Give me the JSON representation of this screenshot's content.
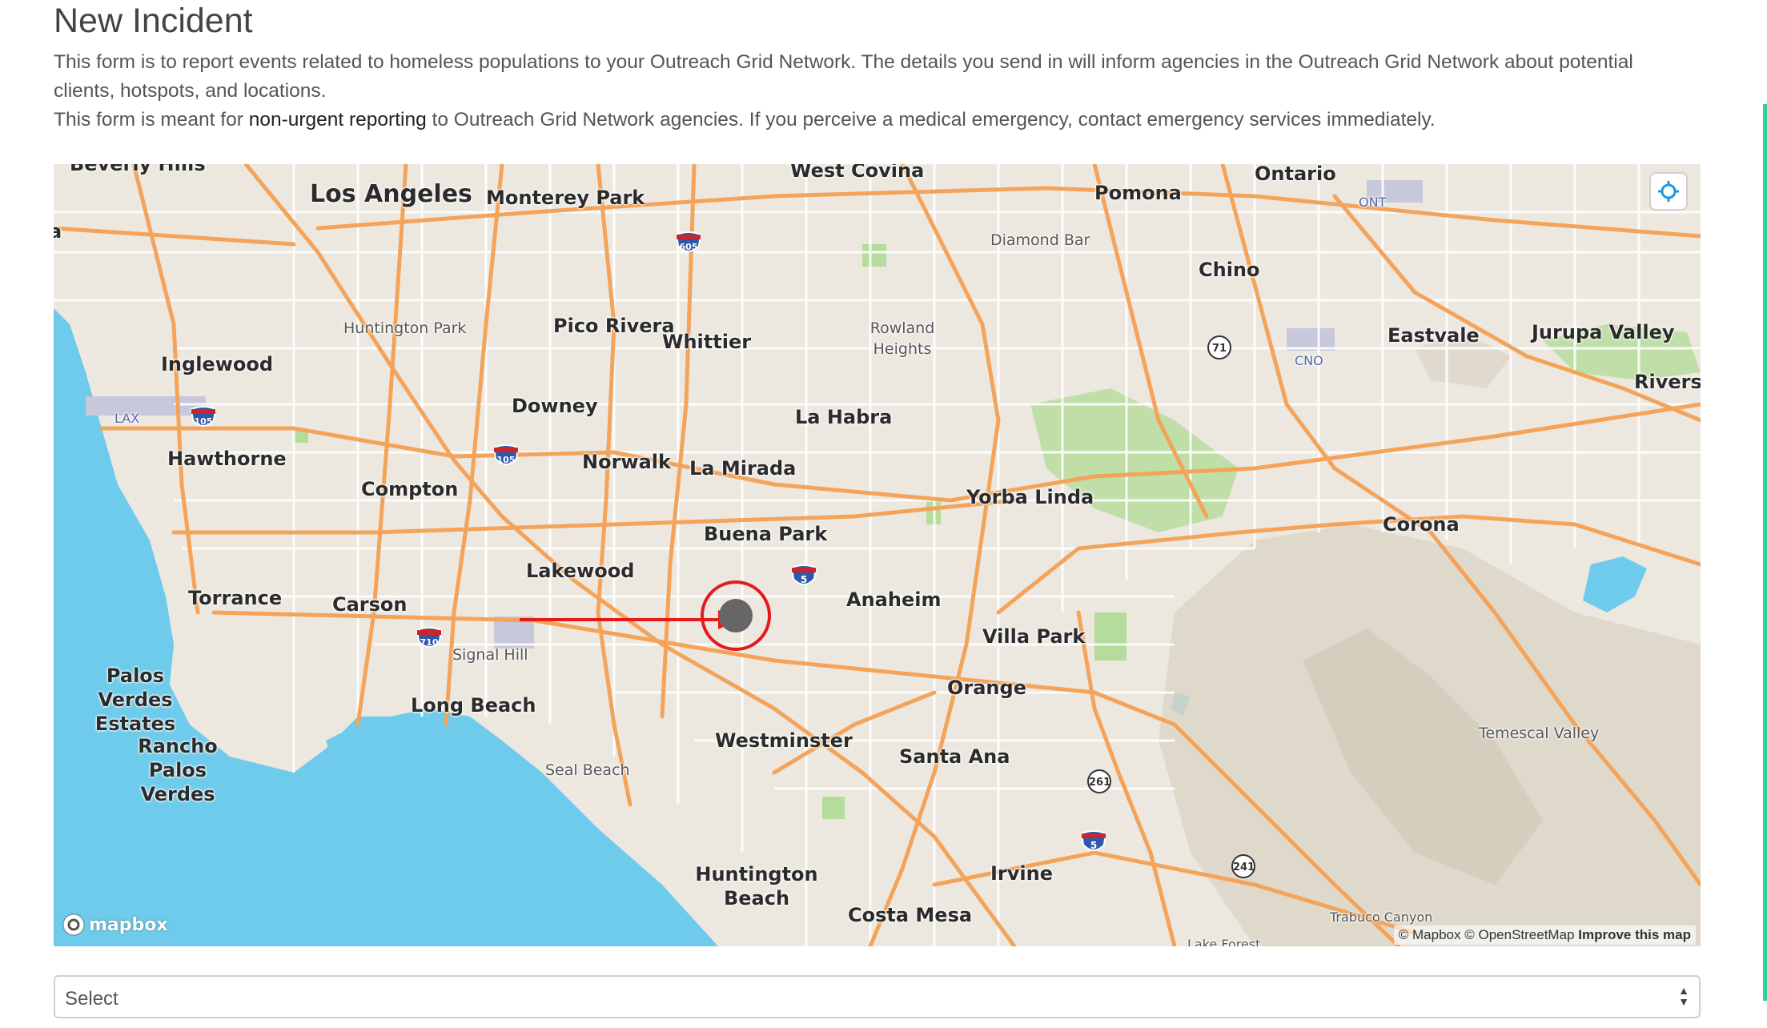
{
  "page": {
    "title": "New Incident",
    "intro_line1": "This form is to report events related to homeless populations to your Outreach Grid Network. The details you send in will inform agencies in the Outreach Grid Network about potential clients, hotspots, and locations.",
    "intro_line2_before": "This form is meant for ",
    "intro_line2_highlight": "non-urgent reporting",
    "intro_line2_after": " to Outreach Grid Network agencies. If you perceive a medical emergency, contact emergency services immediately."
  },
  "map": {
    "labels": {
      "beverly_hills": "Beverly Hills",
      "los_angeles": "Los Angeles",
      "monterey_park": "Monterey Park",
      "west_covina": "West Covina",
      "ontario": "Ontario",
      "pomona": "Pomona",
      "diamond_bar": "Diamond Bar",
      "chino": "Chino",
      "huntington_park": "Huntington Park",
      "pico_rivera": "Pico Rivera",
      "whittier": "Whittier",
      "rowland_heights": "Rowland Heights",
      "eastvale": "Eastvale",
      "jurupa_valley": "Jurupa Valley",
      "riverside": "Riversic",
      "inglewood": "Inglewood",
      "downey": "Downey",
      "la_habra": "La Habra",
      "hawthorne": "Hawthorne",
      "norwalk": "Norwalk",
      "la_mirada": "La Mirada",
      "compton": "Compton",
      "yorba_linda": "Yorba Linda",
      "buena_park": "Buena Park",
      "corona": "Corona",
      "lakewood": "Lakewood",
      "anaheim": "Anaheim",
      "torrance": "Torrance",
      "carson": "Carson",
      "villa_park": "Villa Park",
      "signal_hill": "Signal Hill",
      "palos_verdes_estates": "Palos Verdes Estates",
      "orange": "Orange",
      "long_beach": "Long Beach",
      "westminster": "Westminster",
      "santa_ana": "Santa Ana",
      "temescal_valley": "Temescal Valley",
      "rancho_palos_verdes": "Rancho Palos Verdes",
      "seal_beach": "Seal Beach",
      "huntington_beach": "Huntington Beach",
      "irvine": "Irvine",
      "costa_mesa": "Costa Mesa",
      "trabuco_canyon": "Trabuco Canyon",
      "lake_forest": "Lake Forest",
      "la_partial": "a"
    },
    "airports": {
      "ont": "ONT",
      "cno": "CNO",
      "lax": "LAX"
    },
    "shields": {
      "i605": "605",
      "i105a": "105",
      "i105b": "105",
      "i5a": "5",
      "i5b": "5",
      "i710": "710",
      "r71": "71",
      "r261": "261",
      "r241": "241"
    },
    "logo": "mapbox",
    "attribution_1": "© Mapbox",
    "attribution_2": "© OpenStreetMap",
    "attribution_link": "Improve this map",
    "icons": {
      "geolocate": "crosshair-icon",
      "marker": "location-marker-icon"
    },
    "colors": {
      "water": "#6ecbeb",
      "land": "#ece8e0",
      "highway": "#f4a35a",
      "park": "#b5dc9a",
      "marker_ring": "#e31b1b",
      "marker_dot": "#666666"
    }
  },
  "form": {
    "select_value": "Select"
  }
}
